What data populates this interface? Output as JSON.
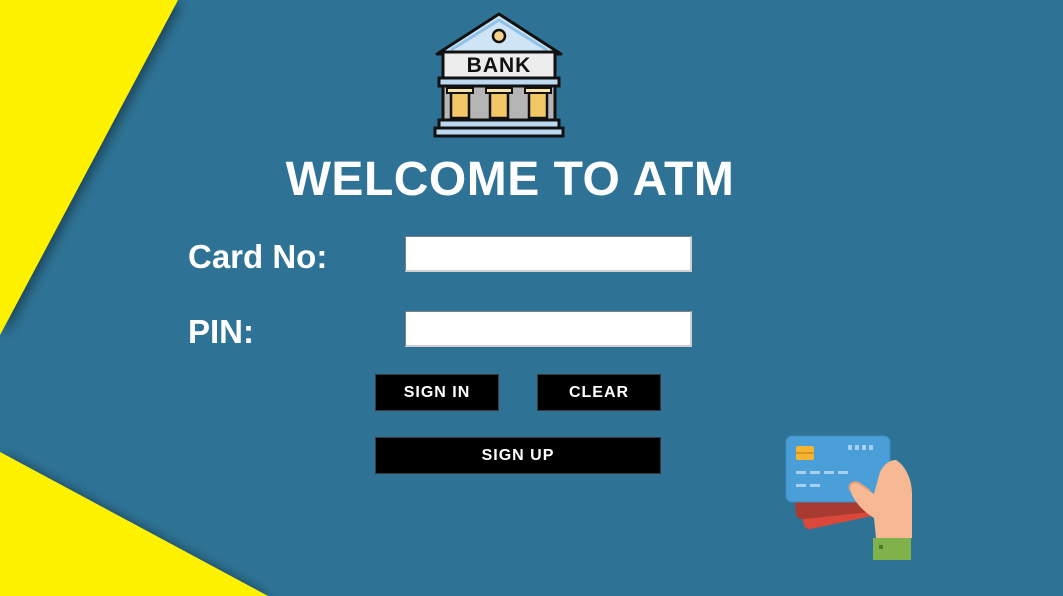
{
  "header": {
    "bank_sign": "BANK",
    "title": "WELCOME TO ATM"
  },
  "form": {
    "card_label": "Card No:",
    "card_value": "",
    "pin_label": "PIN:",
    "pin_value": ""
  },
  "buttons": {
    "sign_in": "SIGN IN",
    "clear": "CLEAR",
    "sign_up": "SIGN UP"
  },
  "colors": {
    "background": "#2e7395",
    "accent_yellow": "#fff200",
    "button": "#000000",
    "text": "#ffffff"
  },
  "icons": [
    "bank-building-icon",
    "hand-holding-cards-icon"
  ]
}
